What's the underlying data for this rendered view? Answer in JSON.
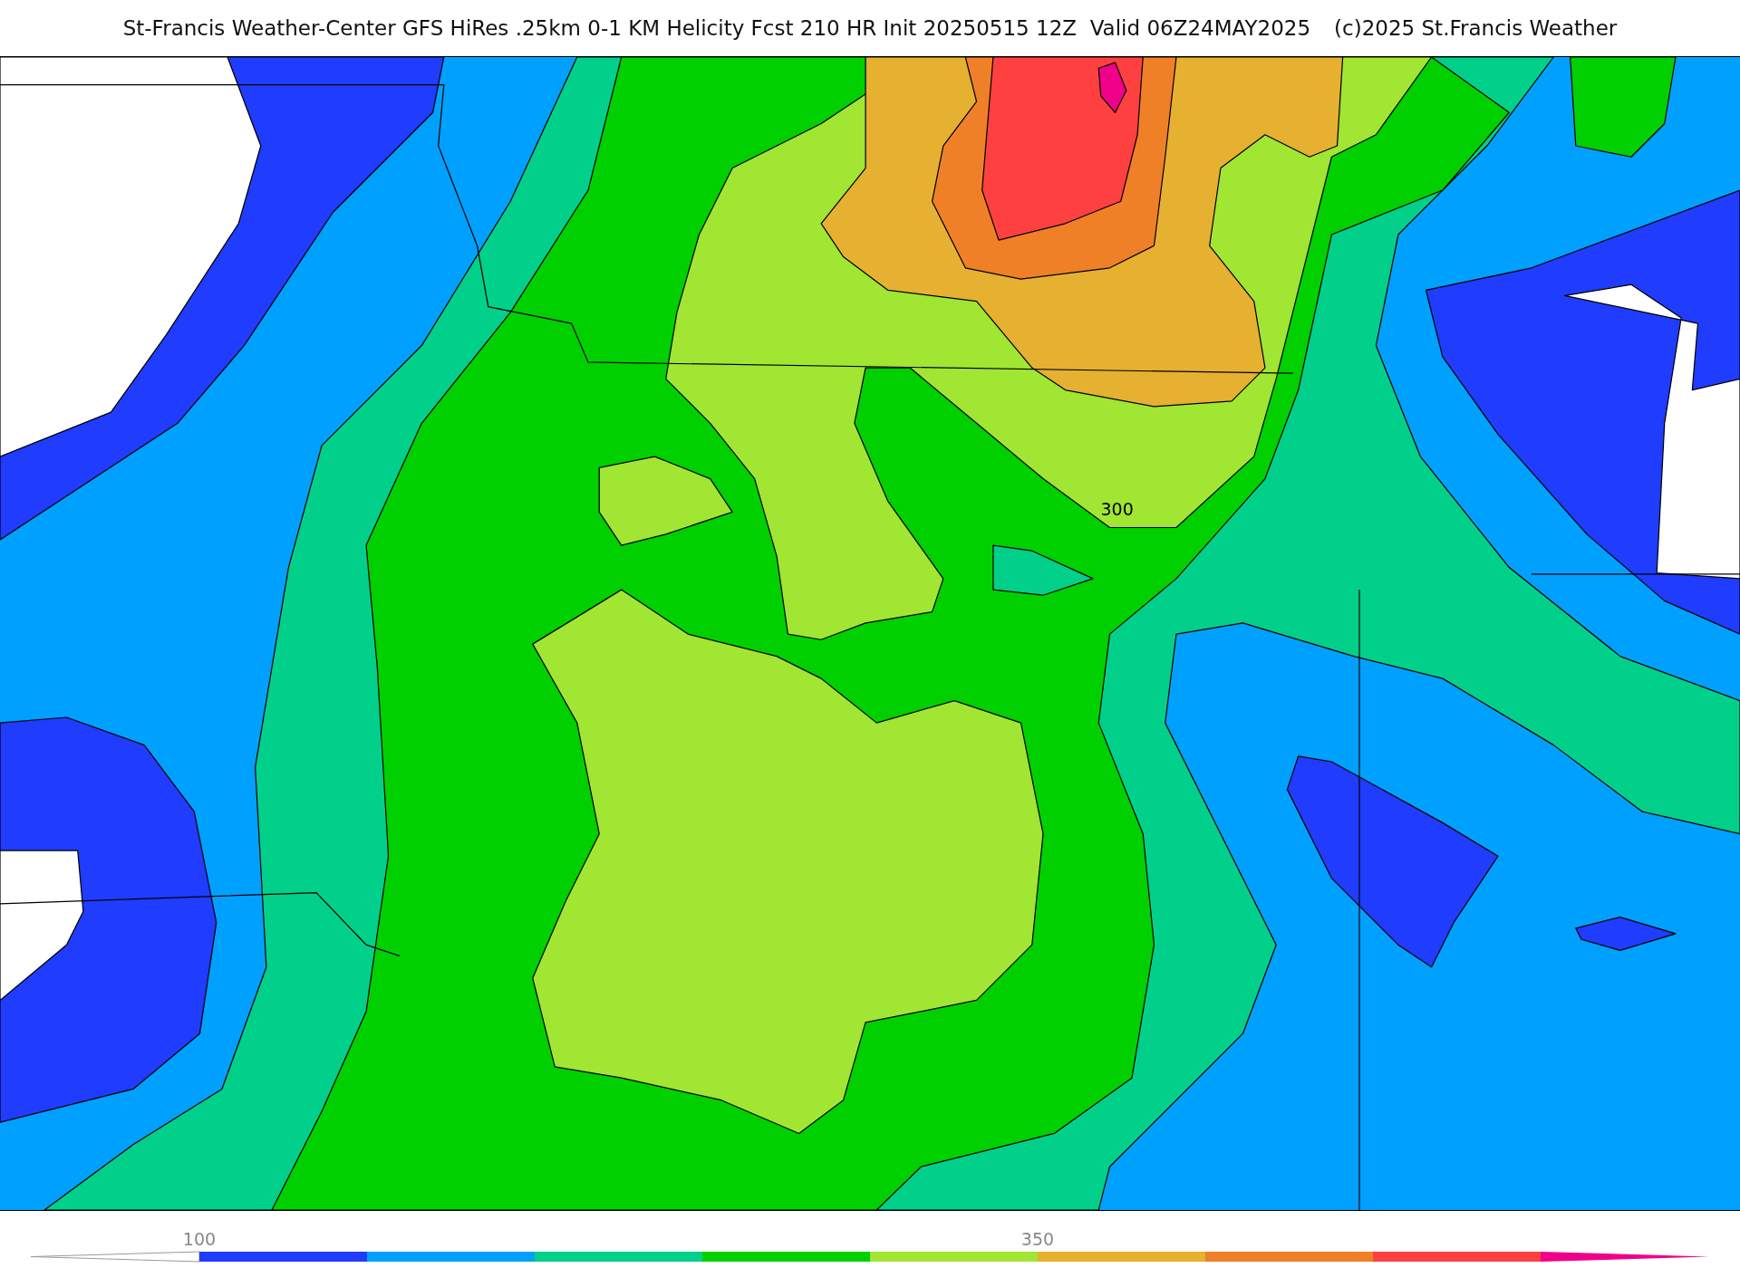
{
  "title": "St-Francis Weather-Center GFS HiRes .25km 0-1 KM Helicity Fcst 210 HR Init 20250515 12Z  Valid 06Z24MAY2025",
  "copyright": "(c)2025 St.Francis Weather",
  "map": {
    "contour_label": "300"
  },
  "colorbar": {
    "bins": [
      {
        "color": "#1f3cff",
        "label": "100"
      },
      {
        "color": "#00a0ff"
      },
      {
        "color": "#00d08a"
      },
      {
        "color": "#00d000"
      },
      {
        "color": "#a0e632"
      },
      {
        "color": "#e6b030",
        "label": "350"
      },
      {
        "color": "#f08028"
      },
      {
        "color": "#ff4040"
      }
    ]
  }
}
